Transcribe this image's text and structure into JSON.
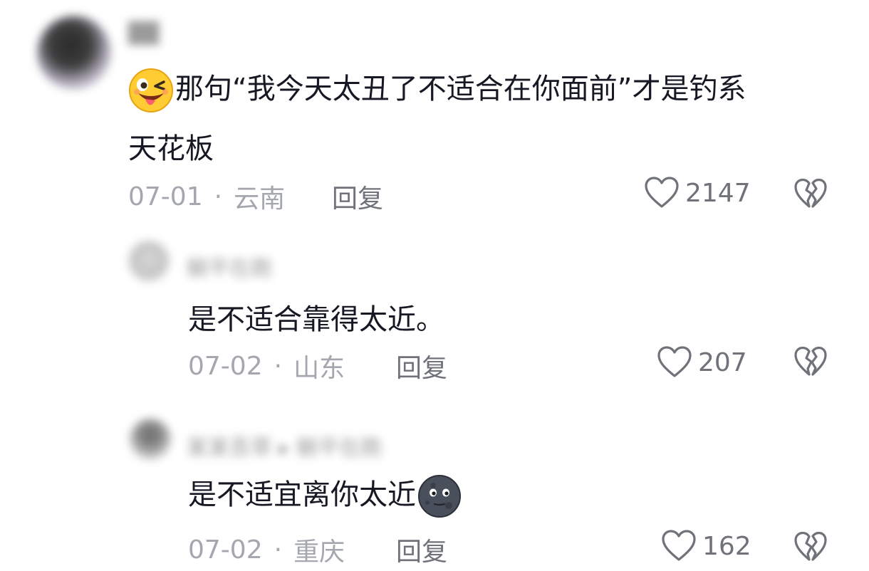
{
  "colors": {
    "text": "#161823",
    "meta": "#a4a7ae",
    "action": "#6f7279"
  },
  "comments": [
    {
      "username": "██",
      "leading_emoji": "wink-tongue-emoji",
      "line1": "那句“我今天太丑了不适合在你面前”才是钓系",
      "line2": "天花板",
      "date": "07-01",
      "separator": "·",
      "location": "云南",
      "reply_label": "回复",
      "likes": "2147",
      "icons": [
        "heart-icon",
        "broken-heart-icon"
      ]
    },
    {
      "username": "躺平在跑",
      "text": "是不适合靠得太近。",
      "date": "07-02",
      "separator": "·",
      "location": "山东",
      "reply_label": "回复",
      "likes": "207",
      "icons": [
        "heart-icon",
        "broken-heart-icon"
      ]
    },
    {
      "username": "某某吾草 ▸ 躺平在跑",
      "text": "是不适宜离你太近",
      "trailing_emoji": "new-moon-face-emoji",
      "date": "07-02",
      "separator": "·",
      "location": "重庆",
      "reply_label": "回复",
      "likes": "162",
      "icons": [
        "heart-icon",
        "broken-heart-icon"
      ]
    }
  ]
}
